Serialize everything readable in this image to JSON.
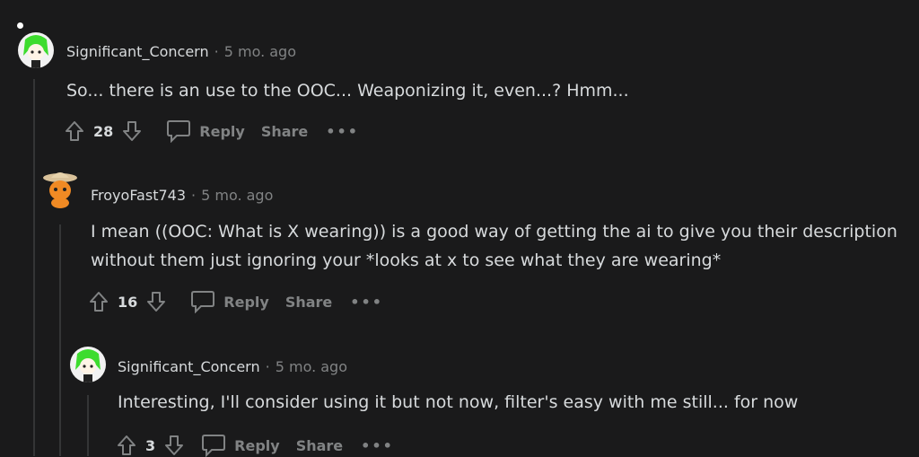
{
  "comments": [
    {
      "username": "Significant_Concern",
      "time": "5 mo. ago",
      "body": "So... there is an use to the OOC... Weaponizing it, even...? Hmm...",
      "votes": "28",
      "reply_label": "Reply",
      "share_label": "Share",
      "more_label": "•••"
    },
    {
      "username": "FroyoFast743",
      "time": "5 mo. ago",
      "body": "I mean ((OOC: What is X wearing)) is a good way of getting the ai to give you their description without them just ignoring your *looks at x to see what they are wearing*",
      "votes": "16",
      "reply_label": "Reply",
      "share_label": "Share",
      "more_label": "•••"
    },
    {
      "username": "Significant_Concern",
      "time": "5 mo. ago",
      "body": "Interesting, I'll consider using it but not now, filter's easy with me still... for now",
      "votes": "3",
      "reply_label": "Reply",
      "share_label": "Share",
      "more_label": "•••"
    }
  ],
  "separator": "·",
  "colors": {
    "background": "#1a1a1b",
    "text": "#d7dadc",
    "muted": "#818384",
    "thread_line": "#343536"
  }
}
